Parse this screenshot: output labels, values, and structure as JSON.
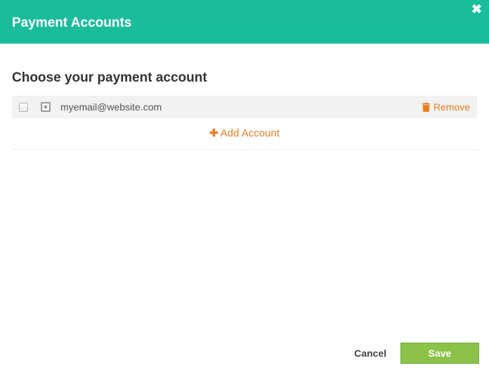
{
  "header": {
    "title": "Payment Accounts"
  },
  "section": {
    "title": "Choose your payment account"
  },
  "accounts": [
    {
      "email": "myemail@website.com",
      "remove_label": "Remove"
    }
  ],
  "actions": {
    "add_account": "Add Account",
    "cancel": "Cancel",
    "save": "Save"
  },
  "colors": {
    "header_bg": "#1abc9c",
    "accent": "#e67e22",
    "save_bg": "#8bc34a"
  }
}
